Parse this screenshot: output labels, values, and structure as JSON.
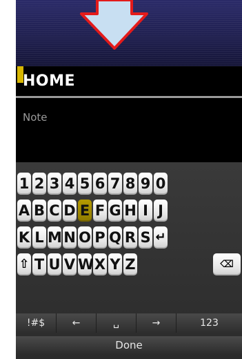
{
  "fields": {
    "name_value": "HOME",
    "note_placeholder": "Note"
  },
  "keyboard": {
    "row1": [
      "1",
      "2",
      "3",
      "4",
      "5",
      "6",
      "7",
      "8",
      "9",
      "0"
    ],
    "row2": [
      "A",
      "B",
      "C",
      "D",
      "E",
      "F",
      "G",
      "H",
      "I",
      "J"
    ],
    "row3": [
      "K",
      "L",
      "M",
      "N",
      "O",
      "P",
      "Q",
      "R",
      "S"
    ],
    "row4": [
      "T",
      "U",
      "V",
      "W",
      "X",
      "Y",
      "Z"
    ],
    "selected_key": "E",
    "shift_symbol": "⇧",
    "backspace_symbol": "⌫",
    "enter_symbol": "↵",
    "func": {
      "symbols_label": "!#$",
      "left_label": "←",
      "space_label": "␣",
      "right_label": "→",
      "numeric_label": "123"
    }
  },
  "done_label": "Done",
  "icons": {
    "header_arrow": "down-arrow-icon"
  }
}
